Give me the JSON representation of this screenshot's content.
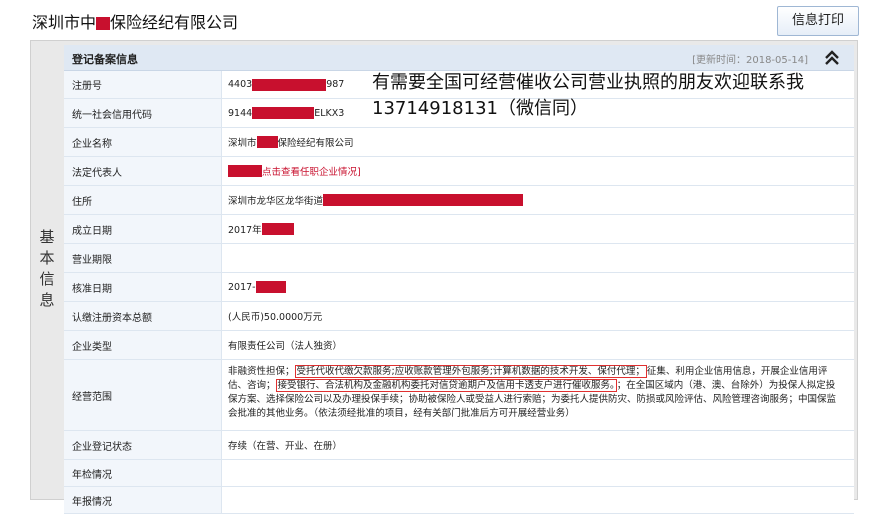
{
  "header": {
    "company_name_prefix": "深圳市中",
    "company_name_suffix": "保险经纪有限公司",
    "print_button": "信息打印"
  },
  "sidebar": {
    "label": "基本信息"
  },
  "section": {
    "title": "登记备案信息",
    "update_time": "[更新时间：2018-05-14]",
    "collapse_icon": "double-chevron-up-icon"
  },
  "overlay": {
    "line1": "有需要全国可经营催收公司营业执照的朋友欢迎联系我",
    "line2": "13714918131（微信同）"
  },
  "fields": {
    "reg_no_label": "注册号",
    "reg_no_prefix": "4403",
    "reg_no_suffix": "987",
    "credit_code_label": "统一社会信用代码",
    "credit_code_prefix": "9144",
    "credit_code_suffix": "ELKX3",
    "name_label": "企业名称",
    "name_prefix": "深圳市",
    "name_suffix": "保险经纪有限公司",
    "legal_rep_label": "法定代表人",
    "legal_rep_link": "点击查看任职企业情况]",
    "address_label": "住所",
    "address_prefix": "深圳市龙华区龙华街道",
    "established_label": "成立日期",
    "established_prefix": "2017年",
    "term_label": "营业期限",
    "term_value": "",
    "approved_label": "核准日期",
    "approved_prefix": "2017-",
    "capital_label": "认缴注册资本总额",
    "capital_value": "(人民币)50.0000万元",
    "type_label": "企业类型",
    "type_value": "有限责任公司（法人独资）",
    "scope_label": "经营范围",
    "scope_part1": "非融资性担保；",
    "scope_boxed1": "受托代收代缴欠款服务;应收账款管理外包服务;计算机数据的技术开发、保付代理；",
    "scope_part2": "征集、利用企业信用信息，开展企业信用评估、咨询；",
    "scope_boxed2": "接受银行、合法机构及金融机构委托对信贷逾期户及信用卡透支户进行催收服务。",
    "scope_part3": "；在全国区域内（港、澳、台除外）为投保人拟定投保方案、选择保险公司以及办理投保手续；协助被保险人或受益人进行索赔；为委托人提供防灾、防损或风险评估、风险管理咨询服务；中国保监会批准的其他业务。（依法须经批准的项目，经有关部门批准后方可开展经营业务）",
    "status_label": "企业登记状态",
    "status_value": "存续（在营、开业、在册）",
    "annual_check_label": "年检情况",
    "annual_check_value": "",
    "annual_report_label": "年报情况",
    "annual_report_value": ""
  },
  "colors": {
    "redaction": "#c8102e",
    "header_bg": "#dfe8f3",
    "label_bg": "#f2f6fb",
    "highlight_border": "#e03030"
  }
}
